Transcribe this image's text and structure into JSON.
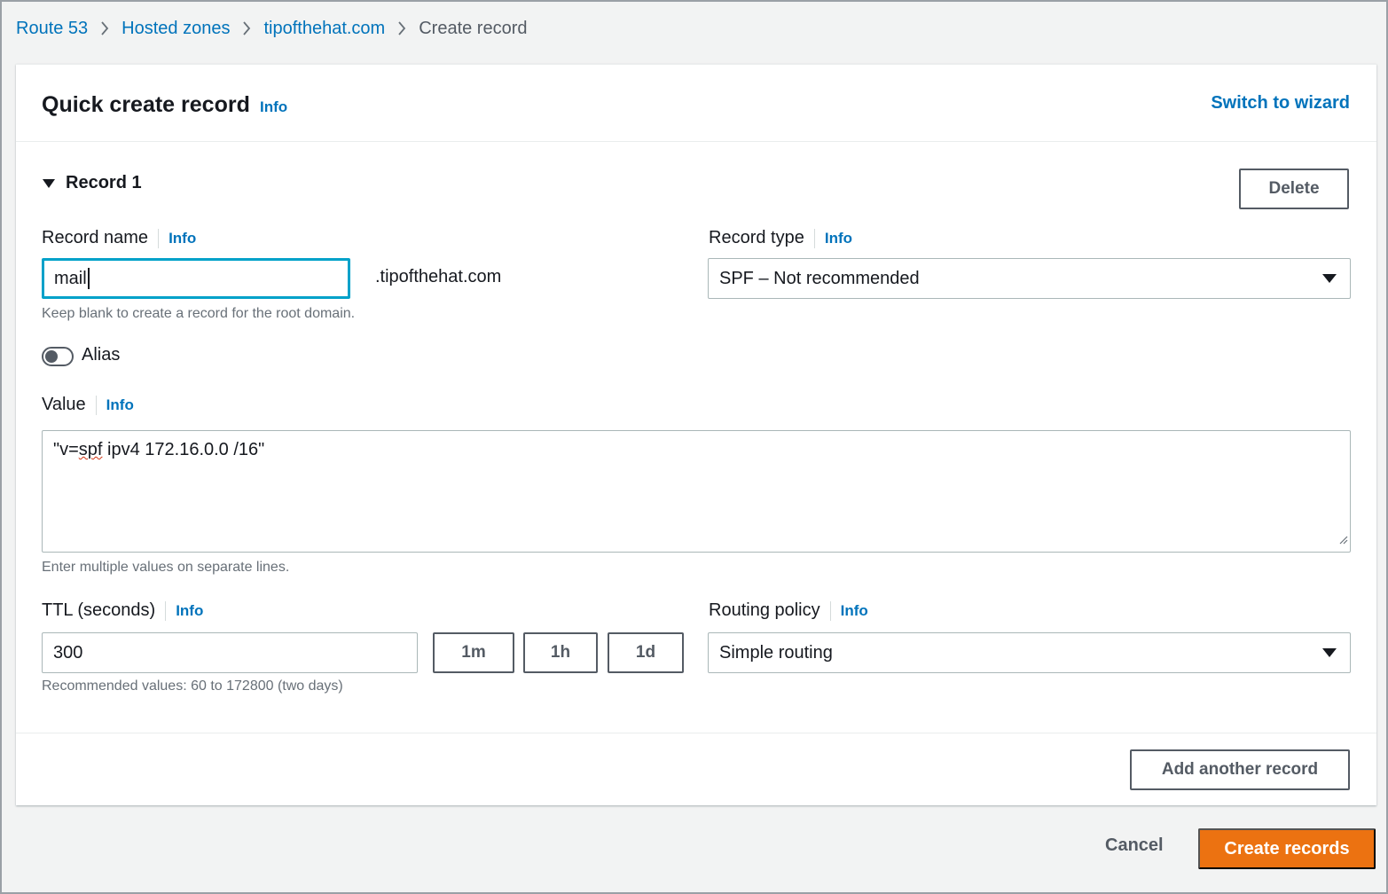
{
  "breadcrumb": {
    "items": [
      "Route 53",
      "Hosted zones",
      "tipofthehat.com"
    ],
    "current": "Create record"
  },
  "panel": {
    "title": "Quick create record",
    "title_info": "Info",
    "switch_wizard": "Switch to wizard"
  },
  "record": {
    "heading": "Record 1",
    "delete_label": "Delete",
    "name": {
      "label": "Record name",
      "info": "Info",
      "value": "mail",
      "suffix": ".tipofthehat.com",
      "hint": "Keep blank to create a record for the root domain."
    },
    "type": {
      "label": "Record type",
      "info": "Info",
      "selected": "SPF – Not recommended"
    },
    "alias": {
      "label": "Alias",
      "enabled": false
    },
    "value": {
      "label": "Value",
      "info": "Info",
      "text_prefix": "\"v=",
      "text_misspelled": "spf",
      "text_suffix": " ipv4 172.16.0.0 /16\"",
      "hint": "Enter multiple values on separate lines."
    },
    "ttl": {
      "label": "TTL (seconds)",
      "info": "Info",
      "value": "300",
      "presets": [
        "1m",
        "1h",
        "1d"
      ],
      "hint": "Recommended values: 60 to 172800 (two days)"
    },
    "routing": {
      "label": "Routing policy",
      "info": "Info",
      "selected": "Simple routing"
    }
  },
  "add_another_label": "Add another record",
  "footer": {
    "cancel_label": "Cancel",
    "create_label": "Create records"
  },
  "colors": {
    "link": "#0073bb",
    "primary_button": "#ec7211",
    "focus": "#00a1c9"
  }
}
